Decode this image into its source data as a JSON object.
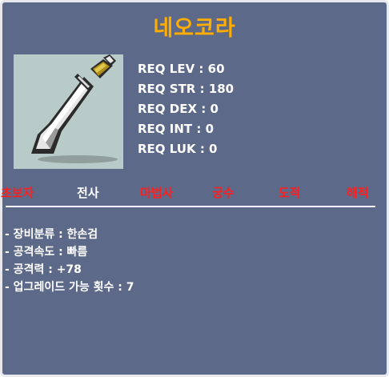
{
  "item": {
    "name": "네오코라",
    "icon": "dagger-sword-icon"
  },
  "requirements": [
    "REQ LEV : 60",
    "REQ STR : 180",
    "REQ DEX : 0",
    "REQ INT : 0",
    "REQ LUK : 0"
  ],
  "jobs": [
    {
      "label": "초보자",
      "color": "#ff1f1f"
    },
    {
      "label": "전사",
      "color": "#ffffff"
    },
    {
      "label": "마법사",
      "color": "#ff1f1f"
    },
    {
      "label": "궁수",
      "color": "#ff1f1f"
    },
    {
      "label": "도적",
      "color": "#ff1f1f"
    },
    {
      "label": "해적",
      "color": "#ff1f1f"
    }
  ],
  "stats": [
    "- 장비분류 : 한손검",
    "- 공격속도 : 빠름",
    "- 공격력 : +78",
    "- 업그레이드 가능 횟수 : 7"
  ],
  "colors": {
    "background": "#5c6989",
    "title": "#ffad00",
    "unavailable_job": "#ff1f1f",
    "available_job": "#ffffff"
  }
}
